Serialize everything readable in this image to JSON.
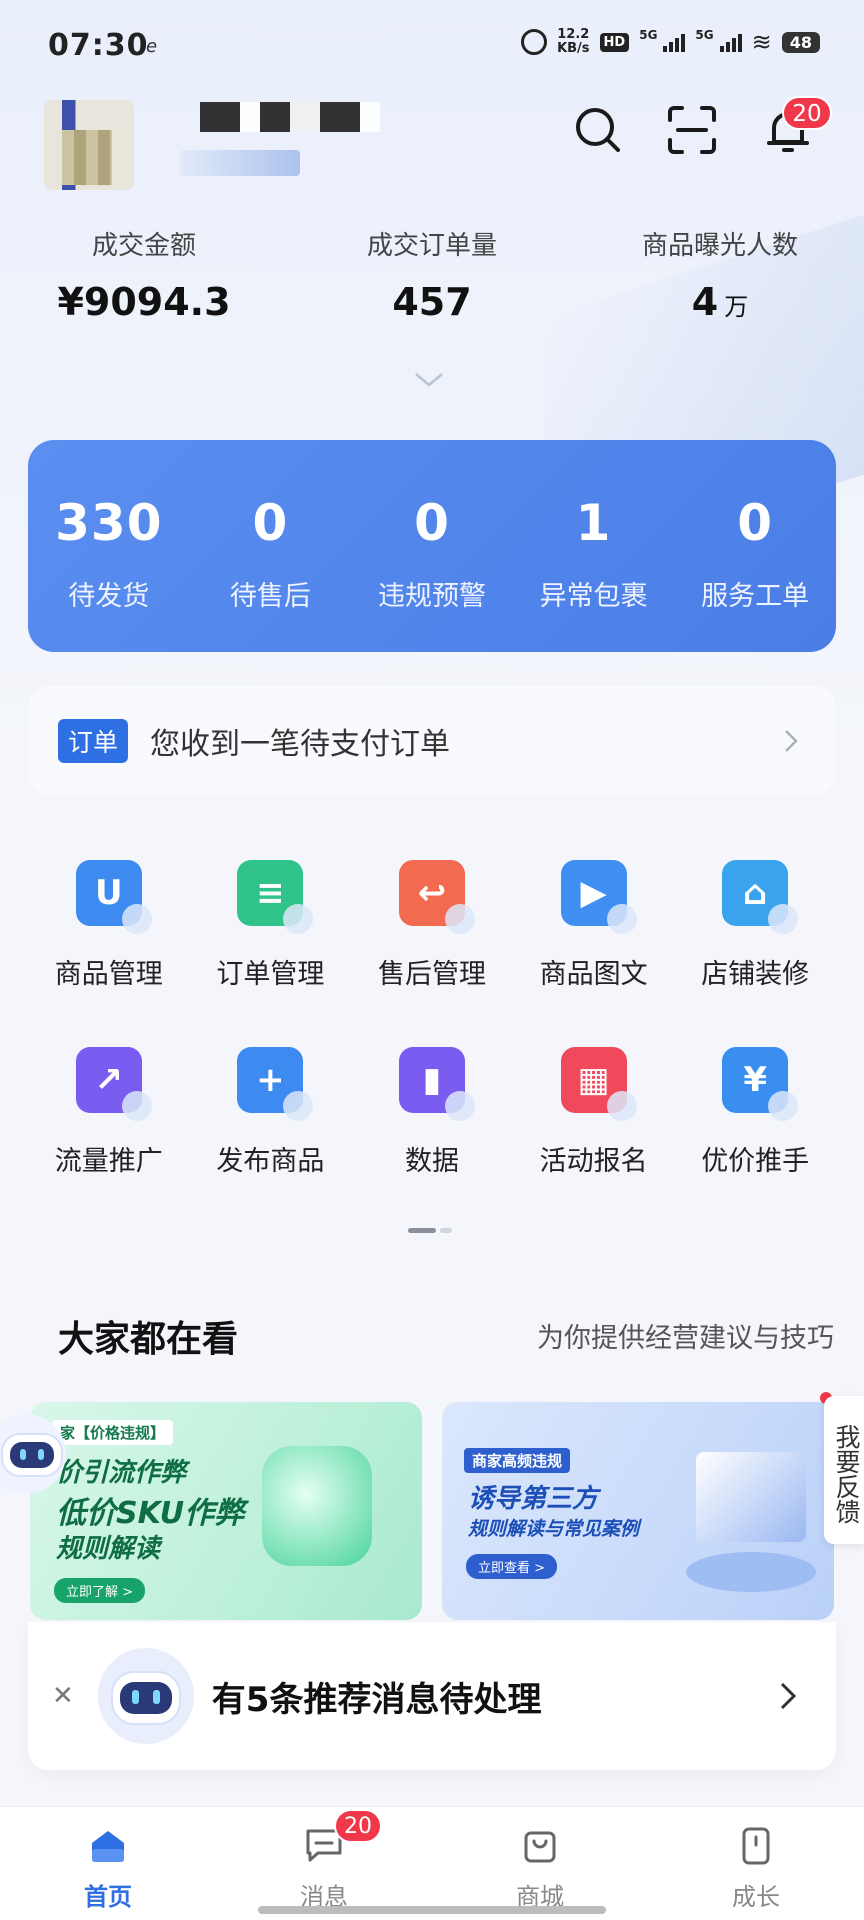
{
  "status_bar": {
    "time": "07:30",
    "carrier_mark": "e",
    "speed_value": "12.2",
    "speed_unit": "KB/s",
    "hd": "HD",
    "sig1": "5G",
    "sig2": "5G",
    "battery": "48"
  },
  "header": {
    "notification_count": "20"
  },
  "stats": [
    {
      "label": "成交金额",
      "value": "¥9094.3",
      "unit": ""
    },
    {
      "label": "成交订单量",
      "value": "457",
      "unit": ""
    },
    {
      "label": "商品曝光人数",
      "value": "4",
      "unit": "万"
    }
  ],
  "task_card": [
    {
      "value": "330",
      "label": "待发货"
    },
    {
      "value": "0",
      "label": "待售后"
    },
    {
      "value": "0",
      "label": "违规预警"
    },
    {
      "value": "1",
      "label": "异常包裹"
    },
    {
      "value": "0",
      "label": "服务工单"
    }
  ],
  "notice": {
    "tag": "订单",
    "text": "您收到一笔待支付订单"
  },
  "grid": [
    {
      "label": "商品管理",
      "icon": "bag-icon",
      "color": "#3d8af0",
      "glyph": "U"
    },
    {
      "label": "订单管理",
      "icon": "order-list-icon",
      "color": "#2fc38a",
      "glyph": "≡"
    },
    {
      "label": "售后管理",
      "icon": "return-icon",
      "color": "#f26a4f",
      "glyph": "↩"
    },
    {
      "label": "商品图文",
      "icon": "video-icon",
      "color": "#3f8ef2",
      "glyph": "▶"
    },
    {
      "label": "店铺装修",
      "icon": "storefront-icon",
      "color": "#3aa3ee",
      "glyph": "⌂"
    },
    {
      "label": "流量推广",
      "icon": "rocket-icon",
      "color": "#7a5cf0",
      "glyph": "↗"
    },
    {
      "label": "发布商品",
      "icon": "plus-icon",
      "color": "#3d8af0",
      "glyph": "+"
    },
    {
      "label": "数据",
      "icon": "chart-icon",
      "color": "#7a5cf0",
      "glyph": "▮"
    },
    {
      "label": "活动报名",
      "icon": "calendar-icon",
      "color": "#f0495b",
      "glyph": "▦"
    },
    {
      "label": "优价推手",
      "icon": "price-tag-icon",
      "color": "#3a8ef0",
      "glyph": "¥"
    }
  ],
  "section": {
    "title": "大家都在看",
    "subtitle": "为你提供经营建议与技巧"
  },
  "banners": [
    {
      "tag": "家【价格违规】",
      "line1": "价引流作弊",
      "line2": "低价SKU作弊",
      "line3": "规则解读",
      "button": "立即了解 >"
    },
    {
      "tag": "商家高频违规",
      "line1": "诱导第三方",
      "line2": "规则解读与常见案例",
      "button": "立即查看 >"
    }
  ],
  "feedback": "我要反馈",
  "popup": {
    "text": "有5条推荐消息待处理"
  },
  "tabs": [
    {
      "label": "首页",
      "icon": "home-icon",
      "active": true
    },
    {
      "label": "消息",
      "icon": "message-icon",
      "badge": "20"
    },
    {
      "label": "商城",
      "icon": "mall-icon"
    },
    {
      "label": "成长",
      "icon": "growth-icon"
    }
  ],
  "colors": {
    "accent": "#2f6fe4",
    "card_blue": "#4f84ea",
    "badge_red": "#f0384a"
  }
}
